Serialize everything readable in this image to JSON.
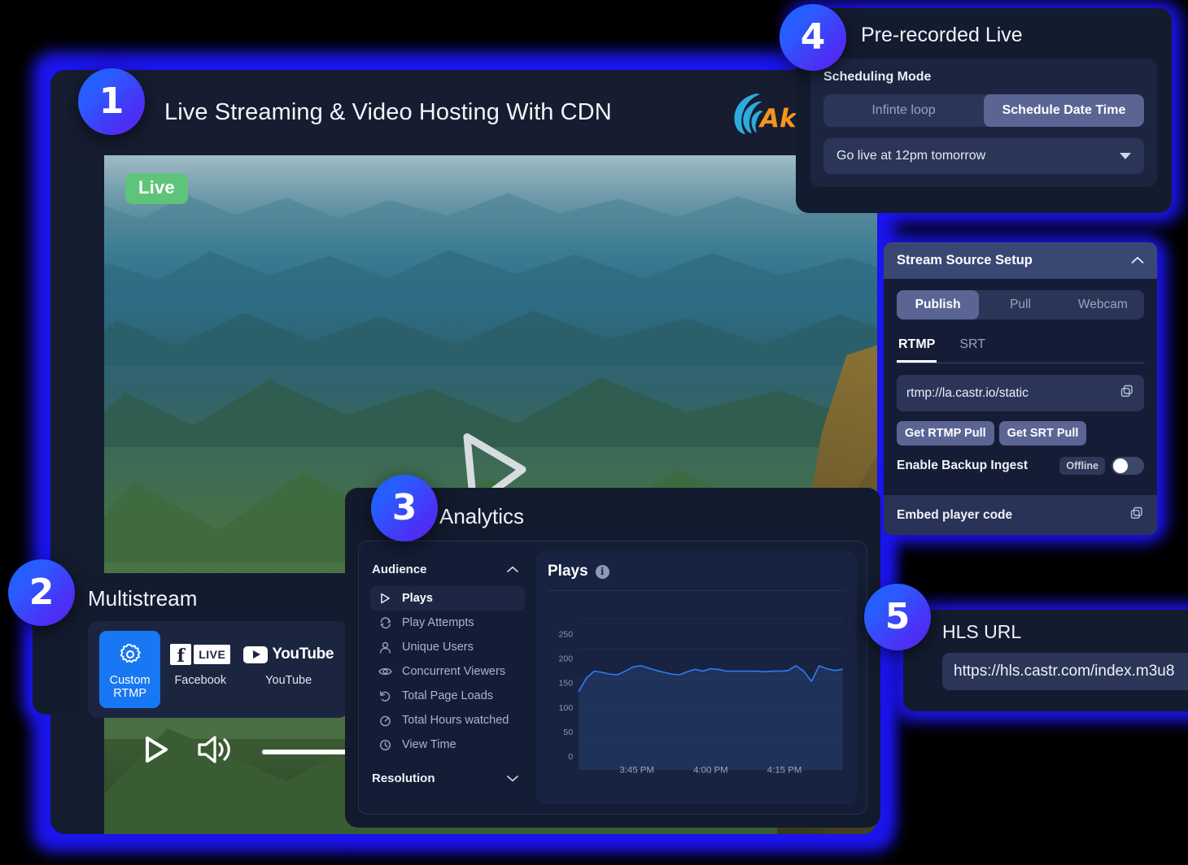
{
  "player": {
    "step_number": "1",
    "title": "Live Streaming & Video Hosting With CDN",
    "brand_logo": "akamai-logo",
    "brand_name": "Akamai",
    "live_badge": "Live",
    "play_icon": "play-icon",
    "volume_icon": "volume-icon",
    "volume_percent": "83"
  },
  "multistream": {
    "step_number": "2",
    "title": "Multistream",
    "platforms": [
      {
        "label": "Custom RTMP",
        "icon": "gear-icon",
        "active": true
      },
      {
        "label": "Facebook",
        "icon": "facebook-live-icon",
        "badge": "LIVE",
        "active": false
      },
      {
        "label": "YouTube",
        "icon": "youtube-icon",
        "wordmark": "YouTube",
        "active": false
      }
    ]
  },
  "analytics": {
    "step_number": "3",
    "title": "Analytics",
    "sidebar": {
      "section_audience": "Audience",
      "section_resolution": "Resolution",
      "items": [
        {
          "label": "Plays",
          "icon": "play-icon",
          "active": true
        },
        {
          "label": "Play Attempts",
          "icon": "refresh-icon",
          "active": false
        },
        {
          "label": "Unique Users",
          "icon": "user-icon",
          "active": false
        },
        {
          "label": "Concurrent Viewers",
          "icon": "eye-icon",
          "active": false
        },
        {
          "label": "Total Page Loads",
          "icon": "undo-icon",
          "active": false
        },
        {
          "label": "Total Hours watched",
          "icon": "stopwatch-icon",
          "active": false
        },
        {
          "label": "View Time",
          "icon": "clock-icon",
          "active": false
        }
      ]
    },
    "chart_title": "Plays",
    "info_icon": "info-icon"
  },
  "chart_data": {
    "type": "area",
    "title": "Plays",
    "xlabel": "",
    "ylabel": "",
    "ylim": [
      0,
      270
    ],
    "yticks": [
      0,
      50,
      100,
      150,
      200,
      250
    ],
    "ytick_labels": [
      "0",
      "50",
      "100",
      "150",
      "200",
      "250"
    ],
    "xtick_labels": [
      "3:45 PM",
      "4:00 PM",
      "4:15 PM"
    ],
    "xtick_positions": [
      0.22,
      0.5,
      0.78
    ],
    "grid": true,
    "legend": "none",
    "line_color": "#2f7cf6",
    "fill_color": "#27406f",
    "values": [
      130,
      152,
      163,
      161,
      158,
      157,
      163,
      170,
      172,
      168,
      164,
      161,
      158,
      157,
      162,
      166,
      163,
      167,
      166,
      163,
      163,
      163,
      163,
      163,
      162,
      163,
      163,
      164,
      172,
      163,
      146,
      172,
      167,
      164,
      166
    ]
  },
  "prerecorded": {
    "step_number": "4",
    "title": "Pre-recorded Live",
    "scheduling_label": "Scheduling Mode",
    "modes": [
      {
        "label": "Infinte loop",
        "active": false
      },
      {
        "label": "Schedule Date Time",
        "active": true
      }
    ],
    "schedule_value": "Go live at 12pm tomorrow",
    "dropdown_icon": "chevron-down-icon"
  },
  "source_setup": {
    "title": "Stream Source Setup",
    "collapse_icon": "chevron-up-icon",
    "source_tabs": [
      {
        "label": "Publish",
        "active": true
      },
      {
        "label": "Pull",
        "active": false
      },
      {
        "label": "Webcam",
        "active": false
      }
    ],
    "protocol_tabs": [
      {
        "label": "RTMP",
        "active": true
      },
      {
        "label": "SRT",
        "active": false
      }
    ],
    "url_value": "rtmp://la.castr.io/static",
    "copy_icon": "copy-icon",
    "buttons": [
      {
        "label": "Get RTMP Pull"
      },
      {
        "label": "Get SRT Pull"
      }
    ],
    "backup_label": "Enable Backup Ingest",
    "backup_status": "Offline",
    "embed_label": "Embed player code"
  },
  "hls": {
    "step_number": "5",
    "title": "HLS URL",
    "url_value": "https://hls.castr.com/index.m3u8"
  },
  "colors": {
    "glow_blue": "#1b14ef",
    "badge_gradient_from": "#1961ff",
    "badge_gradient_to": "#5b25f0",
    "accent_blue": "#1877f2",
    "live_green": "#5ec47a",
    "chart_line": "#2f7cf6",
    "akamai_orange": "#f7941e",
    "akamai_blue": "#2eaadc"
  }
}
